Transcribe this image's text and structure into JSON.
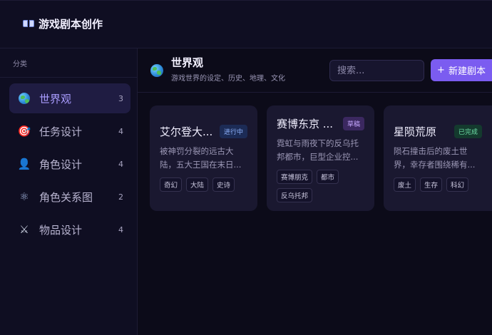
{
  "app": {
    "title": "游戏剧本创作",
    "icon": "book-icon"
  },
  "sidebar": {
    "heading": "分类",
    "items": [
      {
        "label": "世界观",
        "count": "3",
        "icon": "globe-icon",
        "glyph": "",
        "active": true
      },
      {
        "label": "任务设计",
        "count": "4",
        "icon": "target-icon",
        "glyph": "🎯",
        "active": false
      },
      {
        "label": "角色设计",
        "count": "4",
        "icon": "person-icon",
        "glyph": "👤",
        "active": false
      },
      {
        "label": "角色关系图",
        "count": "2",
        "icon": "atom-icon",
        "glyph": "⚛",
        "active": false
      },
      {
        "label": "物品设计",
        "count": "4",
        "icon": "crossed-swords-icon",
        "glyph": "⚔",
        "active": false
      }
    ]
  },
  "header": {
    "title": "世界观",
    "subtitle": "游戏世界的设定、历史、地理、文化",
    "search_placeholder": "搜索...",
    "new_button": "新建剧本",
    "new_icon": "+"
  },
  "cards": [
    {
      "title": "艾尔登大...",
      "status": "进行中",
      "status_type": "progress",
      "desc_line1": "被神罚分裂的远古大",
      "desc_line2": "陆，五大王国在末日...",
      "tags": [
        "奇幻",
        "大陆",
        "史诗"
      ]
    },
    {
      "title": "赛博东京 ...",
      "status": "草稿",
      "status_type": "draft",
      "desc_line1": "霓虹与雨夜下的反乌托",
      "desc_line2": "邦都市，巨型企业控...",
      "tags": [
        "赛博朋克",
        "都市",
        "反乌托邦"
      ]
    },
    {
      "title": "星陨荒原",
      "status": "已完成",
      "status_type": "done",
      "desc_line1": "陨石撞击后的废土世",
      "desc_line2": "界，幸存者围绕稀有...",
      "tags": [
        "废土",
        "生存",
        "科幻"
      ]
    }
  ],
  "colors": {
    "accent": "#7b5cf0",
    "active_bg": "#1f1c42",
    "card_bg": "#1a1830"
  }
}
